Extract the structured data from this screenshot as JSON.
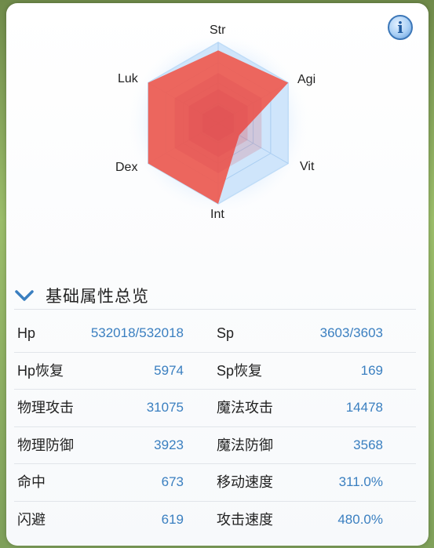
{
  "radar": {
    "axes": [
      "Str",
      "Agi",
      "Vit",
      "Int",
      "Dex",
      "Luk"
    ],
    "values": [
      0.9,
      1.0,
      0.3,
      1.0,
      1.0,
      1.0
    ],
    "fill_color": "#ef5b50",
    "grid_color": "#bfdcf7"
  },
  "info_button": {
    "icon": "info-icon",
    "glyph": "i"
  },
  "section": {
    "title": "基础属性总览",
    "chevron_icon": "chevron-down-icon"
  },
  "stats": [
    {
      "label1": "Hp",
      "value1": "532018/532018",
      "label2": "Sp",
      "value2": "3603/3603"
    },
    {
      "label1": "Hp恢复",
      "value1": "5974",
      "label2": "Sp恢复",
      "value2": "169"
    },
    {
      "label1": "物理攻击",
      "value1": "31075",
      "label2": "魔法攻击",
      "value2": "14478"
    },
    {
      "label1": "物理防御",
      "value1": "3923",
      "label2": "魔法防御",
      "value2": "3568"
    },
    {
      "label1": "命中",
      "value1": "673",
      "label2": "移动速度",
      "value2": "311.0%"
    },
    {
      "label1": "闪避",
      "value1": "619",
      "label2": "攻击速度",
      "value2": "480.0%"
    }
  ]
}
